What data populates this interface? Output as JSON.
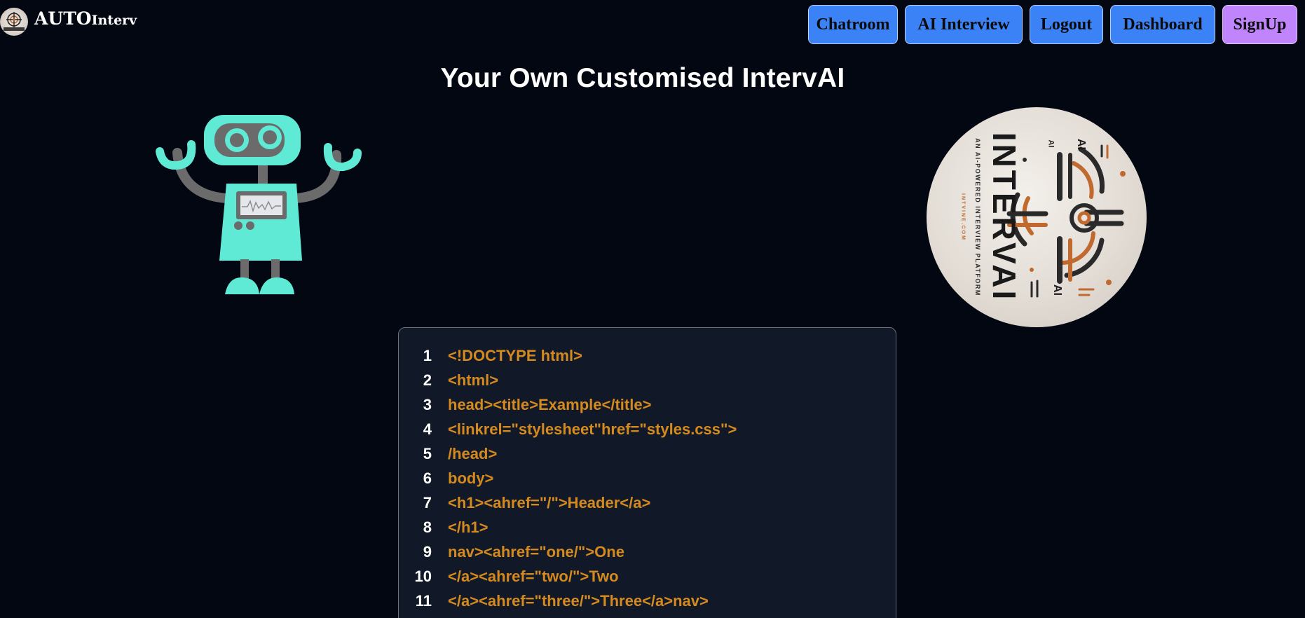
{
  "header": {
    "brand_main": "AUTO",
    "brand_sub": "Interv",
    "logo_icon": "intervai-logo-icon",
    "nav": [
      {
        "label": "Chatroom",
        "color": "#3b82f6"
      },
      {
        "label": "AI Interview",
        "color": "#3b82f6"
      },
      {
        "label": "Logout",
        "color": "#3b82f6"
      },
      {
        "label": "Dashboard",
        "color": "#3b82f6"
      },
      {
        "label": "SignUp",
        "color": "#c084fc"
      }
    ]
  },
  "main": {
    "title": "Your Own Customised IntervAI",
    "robot_icon": "robot-mascot-icon",
    "emblem": {
      "title": "INTERVAI",
      "subtitle": "AN AI-POWERED INTERVIEW PLATFORM",
      "url": "INTVINE.COM",
      "ai_marks": [
        "AI",
        "AI",
        "AI"
      ]
    }
  },
  "code": {
    "lines": [
      {
        "no": "1",
        "text": "<!DOCTYPE html>"
      },
      {
        "no": "2",
        "text": "<html>"
      },
      {
        "no": "3",
        "text": "head><title>Example</title>"
      },
      {
        "no": "4",
        "text": "<linkrel=\"stylesheet\"href=\"styles.css\">"
      },
      {
        "no": "5",
        "text": "/head>"
      },
      {
        "no": "6",
        "text": "body>"
      },
      {
        "no": "7",
        "text": "<h1><ahref=\"/\">Header</a>"
      },
      {
        "no": "8",
        "text": "</h1>"
      },
      {
        "no": "9",
        "text": "nav><ahref=\"one/\">One"
      },
      {
        "no": "10",
        "text": "</a><ahref=\"two/\">Two"
      },
      {
        "no": "11",
        "text": "</a><ahref=\"three/\">Three</a>nav>"
      }
    ]
  },
  "colors": {
    "background": "#030712",
    "nav_button": "#3b82f6",
    "signup_button": "#c084fc",
    "robot": "#5eead4",
    "code_text": "#d48a1e",
    "code_panel": "#111827"
  }
}
